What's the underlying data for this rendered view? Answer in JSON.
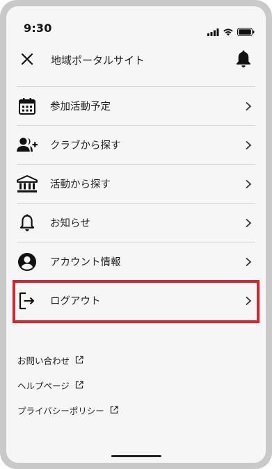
{
  "status_bar": {
    "time": "9:30"
  },
  "header": {
    "title": "地域ポータルサイト",
    "close_icon": "close-icon",
    "bell_icon": "bell-icon"
  },
  "menu": {
    "items": [
      {
        "label": "参加活動予定",
        "icon": "calendar-icon"
      },
      {
        "label": "クラブから探す",
        "icon": "add-user-icon"
      },
      {
        "label": "活動から探す",
        "icon": "institution-icon"
      },
      {
        "label": "お知らせ",
        "icon": "bell-icon"
      },
      {
        "label": "アカウント情報",
        "icon": "account-circle-icon"
      },
      {
        "label": "ログアウト",
        "icon": "logout-icon",
        "highlighted": true
      }
    ]
  },
  "links": [
    {
      "label": "お問い合わせ",
      "icon": "external-link-icon"
    },
    {
      "label": "ヘルプページ",
      "icon": "external-link-icon"
    },
    {
      "label": "プライバシーポリシー",
      "icon": "external-link-icon"
    }
  ],
  "colors": {
    "highlight": "#d6232d",
    "background": "#f6f6f6",
    "frame": "#c9c9c9"
  }
}
